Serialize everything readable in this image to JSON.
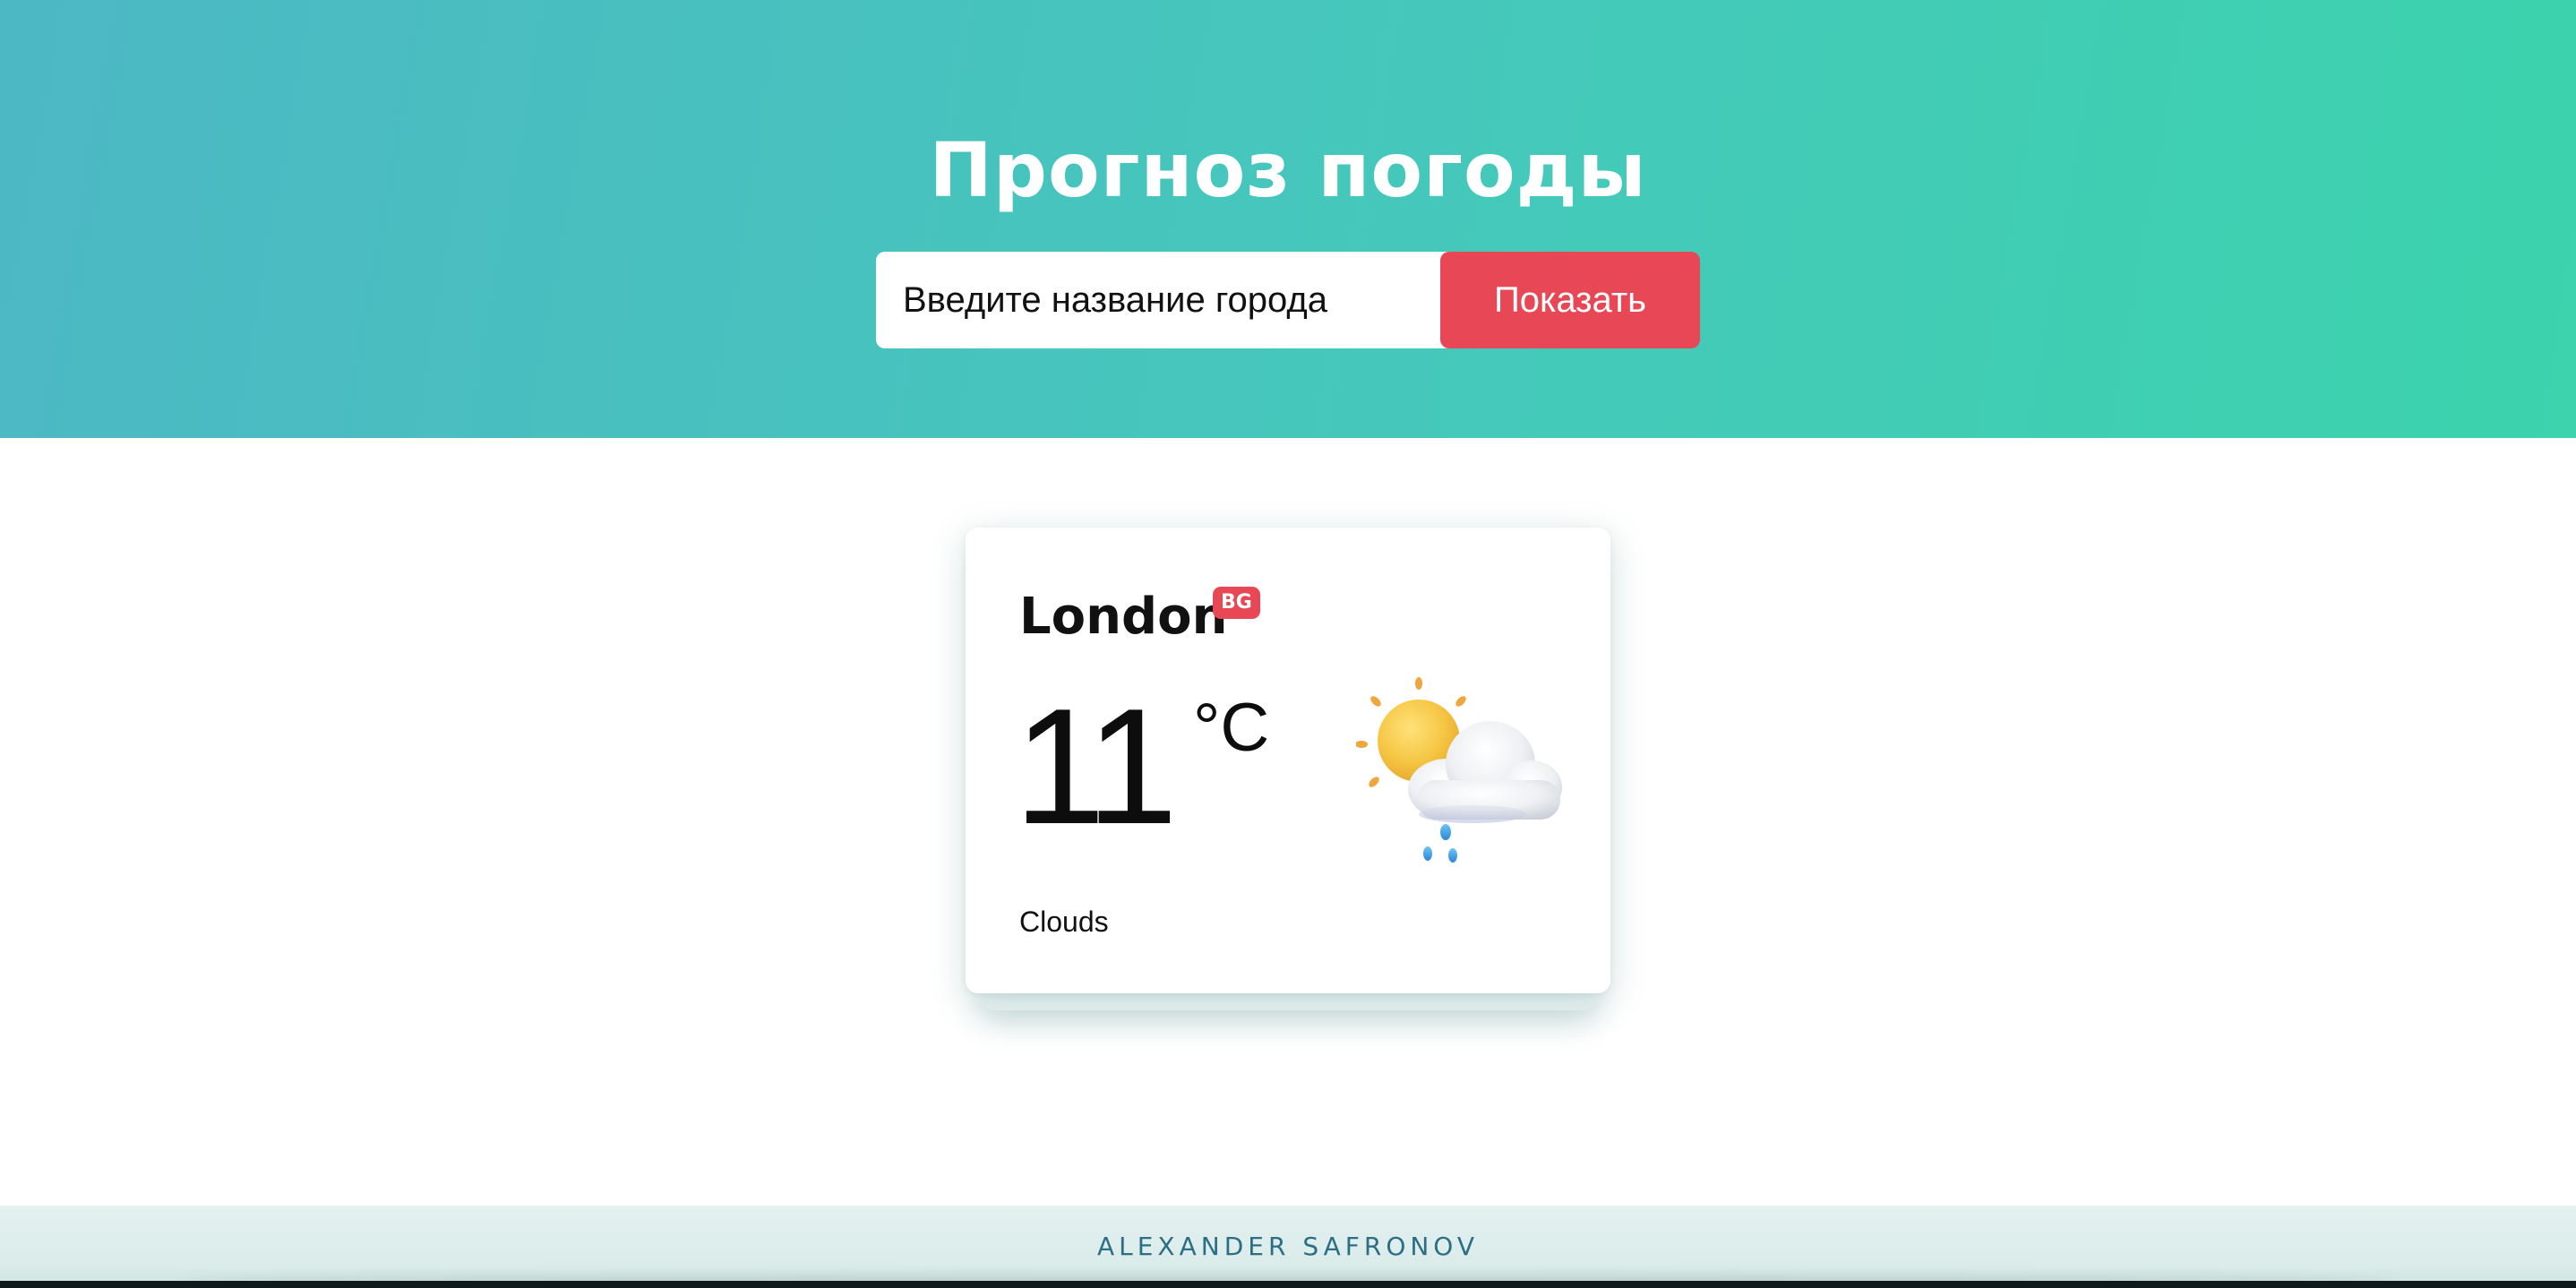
{
  "header": {
    "title": "Прогноз погоды",
    "search": {
      "value": "",
      "placeholder": "Введите название города"
    },
    "submit_label": "Показать"
  },
  "weather_card": {
    "city": "London",
    "country_code": "BG",
    "temperature": "11",
    "unit": "°C",
    "description": "Clouds",
    "icon": "sun-behind-rain-cloud-icon"
  },
  "footer": {
    "author": "ALEXANDER SAFRONOV"
  },
  "colors": {
    "header_gradient_start": "#4cb8c4",
    "header_gradient_end": "#3cd3ad",
    "accent": "#e84855",
    "footer_text": "#2c6e85"
  }
}
